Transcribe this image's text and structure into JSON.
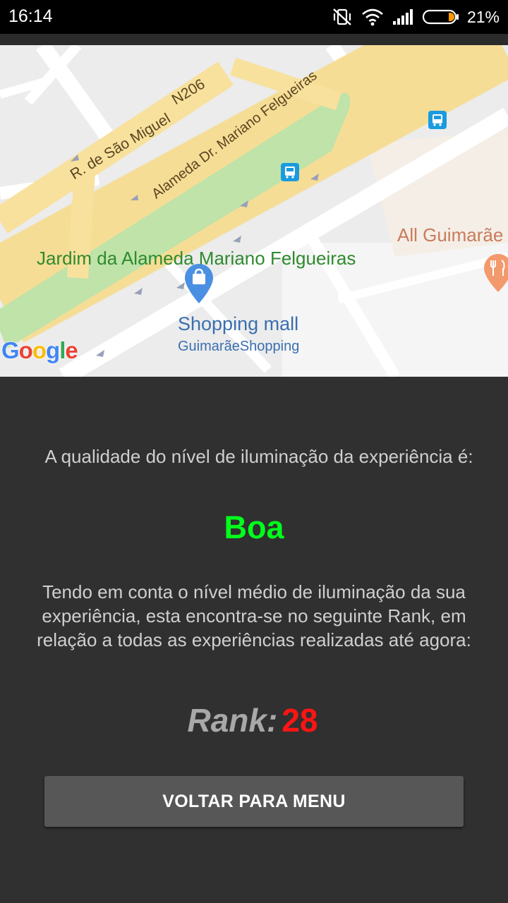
{
  "status_bar": {
    "time": "16:14",
    "battery_percent": "21%",
    "icons": [
      "vibrate-off-icon",
      "wifi-icon",
      "signal-icon",
      "battery-icon"
    ]
  },
  "map": {
    "park_label": "Jardim da Alameda Mariano Felgueiras",
    "street_labels": [
      "R. de São Miguel",
      "N206",
      "Alameda Dr. Mariano Felgueiras"
    ],
    "poi_name": "Shopping mall",
    "poi_subtitle": "GuimarãeShopping",
    "place_label": "All Guimarãe",
    "logo": "Google",
    "colors": {
      "park": "#bfe3a9",
      "road": "#f8e19d",
      "background": "#ececec",
      "bus_stop": "#1a9be0",
      "restaurant": "#f39a6c",
      "poi": "#4a90e2"
    }
  },
  "result": {
    "quality_label": "A qualidade do nível de iluminação da experiência é:",
    "quality_value": "Boa",
    "rank_description": "Tendo em conta o nível médio de iluminação da sua experiência, esta encontra-se no seguinte Rank, em relação a todas as experiências realizadas até agora:",
    "rank_label": "Rank:",
    "rank_value": "28",
    "colors": {
      "quality_value": "#00ff1a",
      "rank_value": "#ff1414"
    }
  },
  "menu_button_label": "VOLTAR PARA MENU"
}
